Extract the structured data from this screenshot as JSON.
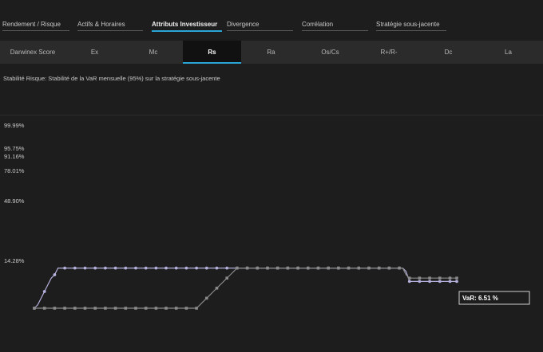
{
  "top_tabs": [
    {
      "label": "Rendement / Risque",
      "active": false
    },
    {
      "label": "Actifs & Horaires",
      "active": false
    },
    {
      "label": "Attributs Investisseur",
      "active": true
    },
    {
      "label": "Divergence",
      "active": false
    },
    {
      "label": "Corrélation",
      "active": false
    },
    {
      "label": "Stratégie sous-jacente",
      "active": false
    }
  ],
  "sub_tabs": [
    {
      "label": "Darwinex Score",
      "active": false
    },
    {
      "label": "Ex",
      "active": false
    },
    {
      "label": "Mc",
      "active": false
    },
    {
      "label": "Rs",
      "active": true
    },
    {
      "label": "Ra",
      "active": false
    },
    {
      "label": "Os/Cs",
      "active": false
    },
    {
      "label": "R+/R-",
      "active": false
    },
    {
      "label": "Dc",
      "active": false
    },
    {
      "label": "La",
      "active": false
    }
  ],
  "description": "Stabilité Risque: Stabilité de la VaR mensuelle (95%) sur la stratégie sous-jacente",
  "colors": {
    "accent": "#2aa6d6",
    "series_purple": "#b4b0dc",
    "series_gray": "#8a8a8a",
    "background": "#1d1d1d"
  },
  "chart_data": {
    "type": "line",
    "title": "",
    "xlabel": "",
    "ylabel": "",
    "y_tick_labels": [
      "99.99%",
      "95.75%",
      "91.16%",
      "78.01%",
      "48.90%",
      "14.28%"
    ],
    "y_tick_values": [
      99.99,
      95.75,
      91.16,
      78.01,
      48.9,
      14.28
    ],
    "ylim": [
      0,
      99.99
    ],
    "grid": false,
    "series": [
      {
        "color": "purple",
        "values": [
          0,
          1,
          3,
          5,
          7,
          9,
          10,
          12,
          12,
          12,
          12,
          12,
          12,
          12,
          12,
          12,
          12,
          12,
          12,
          12,
          12,
          12,
          12,
          12,
          12,
          12,
          12,
          12,
          12,
          12,
          12,
          12,
          12,
          12,
          12,
          12,
          12,
          12,
          12,
          12,
          12,
          12,
          12,
          12,
          12,
          12,
          12,
          12,
          12,
          12,
          12,
          12,
          12,
          12,
          12,
          12,
          12,
          12,
          12,
          12,
          12,
          12,
          12,
          12,
          12,
          12,
          12,
          12,
          12,
          12,
          12,
          12,
          12,
          12,
          12,
          12,
          12,
          12,
          12,
          12,
          12,
          12,
          12,
          12,
          12,
          12,
          12,
          12,
          12,
          12,
          12,
          12,
          12,
          12,
          12,
          12,
          12,
          12,
          12,
          12,
          12,
          12,
          12,
          12,
          12,
          12,
          12,
          12,
          12,
          12,
          11,
          8,
          8,
          8,
          8,
          8,
          8,
          8,
          8,
          8,
          8,
          8,
          8,
          8,
          8,
          8
        ]
      },
      {
        "color": "gray",
        "values": [
          0,
          0,
          0,
          0,
          0,
          0,
          0,
          0,
          0,
          0,
          0,
          0,
          0,
          0,
          0,
          0,
          0,
          0,
          0,
          0,
          0,
          0,
          0,
          0,
          0,
          0,
          0,
          0,
          0,
          0,
          0,
          0,
          0,
          0,
          0,
          0,
          0,
          0,
          0,
          0,
          0,
          0,
          0,
          0,
          0,
          0,
          0,
          0,
          0,
          1,
          2,
          3,
          4,
          5,
          6,
          7,
          8,
          9,
          10,
          11,
          12,
          12,
          12,
          12,
          12,
          12,
          12,
          12,
          12,
          12,
          12,
          12,
          12,
          12,
          12,
          12,
          12,
          12,
          12,
          12,
          12,
          12,
          12,
          12,
          12,
          12,
          12,
          12,
          12,
          12,
          12,
          12,
          12,
          12,
          12,
          12,
          12,
          12,
          12,
          12,
          12,
          12,
          12,
          12,
          12,
          12,
          12,
          12,
          12,
          12,
          10,
          9,
          9,
          9,
          9,
          9,
          9,
          9,
          9,
          9,
          9,
          9,
          9,
          9,
          9,
          9
        ]
      }
    ],
    "tooltip": {
      "label": "VaR:",
      "value": "6.51 %"
    }
  }
}
